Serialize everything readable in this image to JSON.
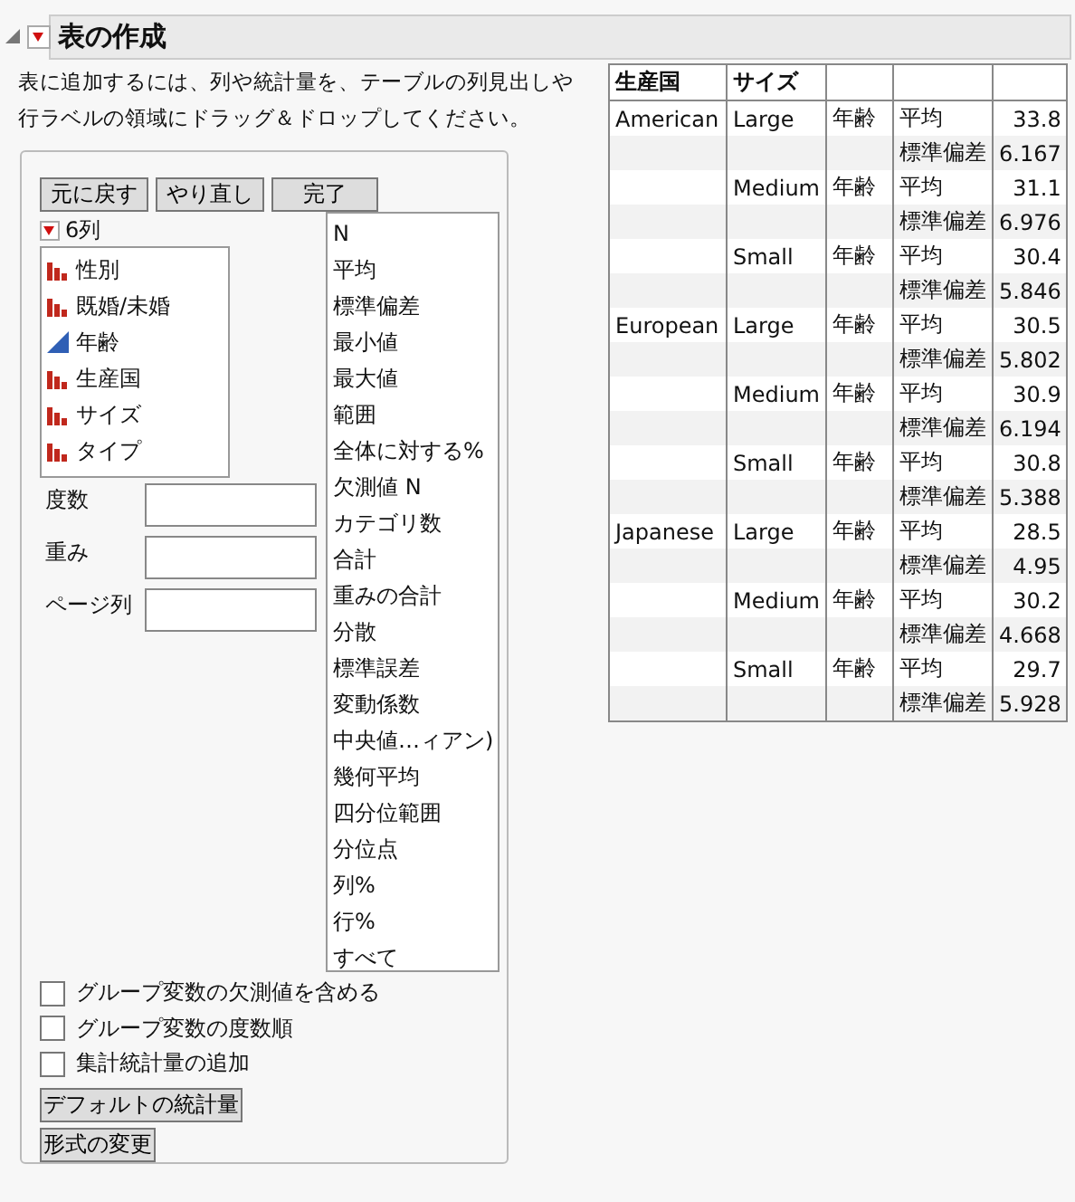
{
  "header": {
    "title": "表の作成",
    "expanded": true
  },
  "instructions": "表に追加するには、列や統計量を、テーブルの列見出しや行ラベルの領域にドラッグ＆ドロップしてください。",
  "toolbar": [
    "元に戻す",
    "やり直し",
    "完了"
  ],
  "columns_menu": {
    "label": "6列"
  },
  "columns": [
    {
      "name": "性別",
      "kind": "nominal"
    },
    {
      "name": "既婚/未婚",
      "kind": "nominal"
    },
    {
      "name": "年齢",
      "kind": "continuous"
    },
    {
      "name": "生産国",
      "kind": "nominal"
    },
    {
      "name": "サイズ",
      "kind": "nominal"
    },
    {
      "name": "タイプ",
      "kind": "nominal"
    }
  ],
  "roles": [
    {
      "label": "度数"
    },
    {
      "label": "重み"
    },
    {
      "label": "ページ列"
    }
  ],
  "statistics": [
    "N",
    "平均",
    "標準偏差",
    "最小値",
    "最大値",
    "範囲",
    "全体に対する%",
    "欠測値 N",
    "カテゴリ数",
    "合計",
    "重みの合計",
    "分散",
    "標準誤差",
    "変動係数",
    "中央値…ィアン)",
    "幾何平均",
    "四分位範囲",
    "分位点",
    "列%",
    "行%",
    "すべて"
  ],
  "options": [
    {
      "label": "グループ変数の欠測値を含める",
      "checked": false
    },
    {
      "label": "グループ変数の度数順",
      "checked": false
    },
    {
      "label": "集計統計量の追加",
      "checked": false
    }
  ],
  "bottom_buttons": [
    "デフォルトの統計量",
    "形式の変更"
  ],
  "table": {
    "headers": [
      "生産国",
      "サイズ"
    ],
    "groups": [
      {
        "country": "American",
        "sizes": [
          {
            "size": "Large",
            "variable": "年齢",
            "stats": [
              {
                "name": "平均",
                "value": "33.8"
              },
              {
                "name": "標準偏差",
                "value": "6.167"
              }
            ]
          },
          {
            "size": "Medium",
            "variable": "年齢",
            "stats": [
              {
                "name": "平均",
                "value": "31.1"
              },
              {
                "name": "標準偏差",
                "value": "6.976"
              }
            ]
          },
          {
            "size": "Small",
            "variable": "年齢",
            "stats": [
              {
                "name": "平均",
                "value": "30.4"
              },
              {
                "name": "標準偏差",
                "value": "5.846"
              }
            ]
          }
        ]
      },
      {
        "country": "European",
        "sizes": [
          {
            "size": "Large",
            "variable": "年齢",
            "stats": [
              {
                "name": "平均",
                "value": "30.5"
              },
              {
                "name": "標準偏差",
                "value": "5.802"
              }
            ]
          },
          {
            "size": "Medium",
            "variable": "年齢",
            "stats": [
              {
                "name": "平均",
                "value": "30.9"
              },
              {
                "name": "標準偏差",
                "value": "6.194"
              }
            ]
          },
          {
            "size": "Small",
            "variable": "年齢",
            "stats": [
              {
                "name": "平均",
                "value": "30.8"
              },
              {
                "name": "標準偏差",
                "value": "5.388"
              }
            ]
          }
        ]
      },
      {
        "country": "Japanese",
        "sizes": [
          {
            "size": "Large",
            "variable": "年齢",
            "stats": [
              {
                "name": "平均",
                "value": "28.5"
              },
              {
                "name": "標準偏差",
                "value": "4.95"
              }
            ]
          },
          {
            "size": "Medium",
            "variable": "年齢",
            "stats": [
              {
                "name": "平均",
                "value": "30.2"
              },
              {
                "name": "標準偏差",
                "value": "4.668"
              }
            ]
          },
          {
            "size": "Small",
            "variable": "年齢",
            "stats": [
              {
                "name": "平均",
                "value": "29.7"
              },
              {
                "name": "標準偏差",
                "value": "5.928"
              }
            ]
          }
        ]
      }
    ]
  }
}
